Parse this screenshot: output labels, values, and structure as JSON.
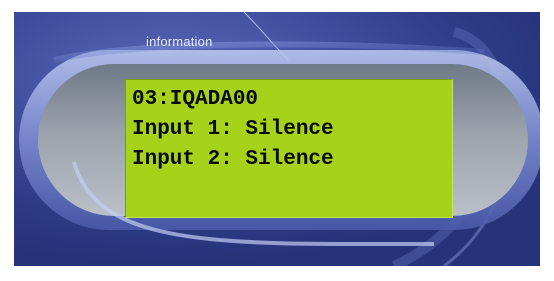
{
  "panel": {
    "label": "information"
  },
  "display": {
    "lines": [
      "03:IQADA00",
      "Input 1: Silence",
      "Input 2: Silence"
    ]
  },
  "colors": {
    "background": "#3d4c9c",
    "lcd_background": "#a6d21a",
    "lcd_text": "#0a0a0a",
    "label_text": "#e6ebff"
  }
}
